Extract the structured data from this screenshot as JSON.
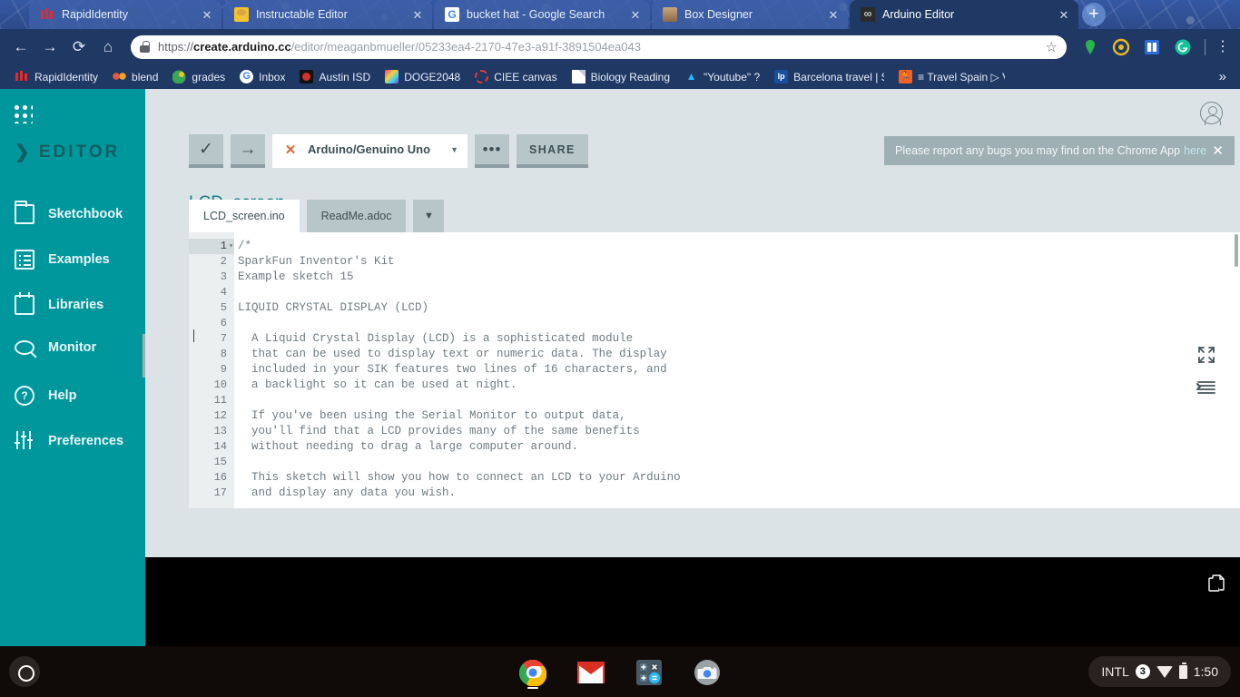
{
  "browser": {
    "tabs": [
      {
        "title": "RapidIdentity",
        "favicon": "rapididentity-icon",
        "active": false
      },
      {
        "title": "Instructable Editor",
        "favicon": "instructables-icon",
        "active": false
      },
      {
        "title": "bucket hat - Google Search",
        "favicon": "google-icon",
        "active": false
      },
      {
        "title": "Box Designer",
        "favicon": "box-designer-icon",
        "active": false
      },
      {
        "title": "Arduino Editor",
        "favicon": "arduino-icon",
        "active": true
      }
    ],
    "new_tab_label": "+",
    "nav": {
      "back": "←",
      "forward": "→",
      "reload": "⟳",
      "home": "⌂"
    },
    "omnibox": {
      "lock_icon": "lock-icon",
      "scheme": "https://",
      "host": "create.arduino.cc",
      "path": "/editor/meaganbmueller/05233ea4-2170-47e3-a91f-3891504ea043",
      "star_icon": "☆"
    },
    "extensions": [
      "green-pin-extension-icon",
      "yellow-circle-extension-icon",
      "blue-book-extension-icon",
      "grammarly-extension-icon"
    ],
    "menu_icon": "⋮",
    "bookmarks": [
      {
        "label": "RapidIdentity",
        "icon": "rapididentity-icon"
      },
      {
        "label": "blend",
        "icon": "blend-icon"
      },
      {
        "label": "grades",
        "icon": "grades-icon"
      },
      {
        "label": "Inbox",
        "icon": "google-inbox-icon"
      },
      {
        "label": "Austin ISD",
        "icon": "austin-isd-icon"
      },
      {
        "label": "DOGE2048",
        "icon": "doge2048-icon"
      },
      {
        "label": "CIEE canvas",
        "icon": "ciee-canvas-icon"
      },
      {
        "label": "Biology Reading",
        "icon": "document-icon"
      },
      {
        "label": "\"Youtube\" ?",
        "icon": "youtube-shortcut-icon"
      },
      {
        "label": "Barcelona travel | Spa",
        "icon": "lonely-planet-icon"
      },
      {
        "label": "≡ Travel Spain ▷ Vis",
        "icon": "travel-spain-icon"
      }
    ],
    "bookmarks_overflow": "»"
  },
  "editor": {
    "sidebar": {
      "apps_icon": "apps-grid-icon",
      "wordmark_chevron": "❯",
      "wordmark": "EDITOR",
      "items": [
        {
          "label": "Sketchbook",
          "icon": "folder-icon"
        },
        {
          "label": "Examples",
          "icon": "list-icon"
        },
        {
          "label": "Libraries",
          "icon": "libraries-icon"
        },
        {
          "label": "Monitor",
          "icon": "monitor-search-icon"
        },
        {
          "label": "Help",
          "icon": "help-question-icon"
        },
        {
          "label": "Preferences",
          "icon": "sliders-icon"
        }
      ]
    },
    "sketch_title": "LCD_screen",
    "avatar_icon": "user-avatar-icon",
    "notification": {
      "text": "Please report any bugs you may find on the Chrome App",
      "link": "here",
      "close": "✕"
    },
    "toolbar": {
      "verify_icon": "✓",
      "verify_name": "verify-button",
      "upload_icon": "→",
      "upload_name": "upload-button",
      "board_x_icon": "✕",
      "board_value": "Arduino/Genuino Uno",
      "board_caret": "▼",
      "more_label": "•••",
      "share_label": "SHARE"
    },
    "file_tabs": [
      {
        "label": "LCD_screen.ino",
        "active": true
      },
      {
        "label": "ReadMe.adoc",
        "active": false
      }
    ],
    "file_tabs_caret": "▼",
    "code": {
      "lines": [
        "/*",
        "SparkFun Inventor's Kit",
        "Example sketch 15",
        "",
        "LIQUID CRYSTAL DISPLAY (LCD)",
        "",
        "  A Liquid Crystal Display (LCD) is a sophisticated module",
        "  that can be used to display text or numeric data. The display",
        "  included in your SIK features two lines of 16 characters, and",
        "  a backlight so it can be used at night.",
        "",
        "  If you've been using the Serial Monitor to output data,",
        "  you'll find that a LCD provides many of the same benefits",
        "  without needing to drag a large computer around.",
        "",
        "  This sketch will show you how to connect an LCD to your Arduino",
        "  and display any data you wish."
      ],
      "line_numbers": [
        "1",
        "2",
        "3",
        "4",
        "5",
        "6",
        "7",
        "8",
        "9",
        "10",
        "11",
        "12",
        "13",
        "14",
        "15",
        "16",
        "17"
      ],
      "current_line": "1",
      "fold_marker": "▾"
    },
    "expand_icon": "fullscreen-expand-icon",
    "indent_icon": "auto-format-icon",
    "console_copy_icon": "copy-icon"
  },
  "shelf": {
    "launcher_icon": "launcher-circle-icon",
    "apps": [
      {
        "name": "chrome-icon"
      },
      {
        "name": "gmail-icon"
      },
      {
        "name": "calculator-icon"
      },
      {
        "name": "camera-icon"
      }
    ],
    "tray": {
      "input_method": "INTL",
      "notification_count": "3",
      "wifi_icon": "wifi-icon",
      "battery_icon": "battery-icon",
      "time": "1:50"
    }
  },
  "colors": {
    "arduino_teal": "#00979c",
    "editor_bg": "#dbe3e6",
    "chrome_navy": "#1f3864",
    "shelf_black": "#100a08"
  }
}
